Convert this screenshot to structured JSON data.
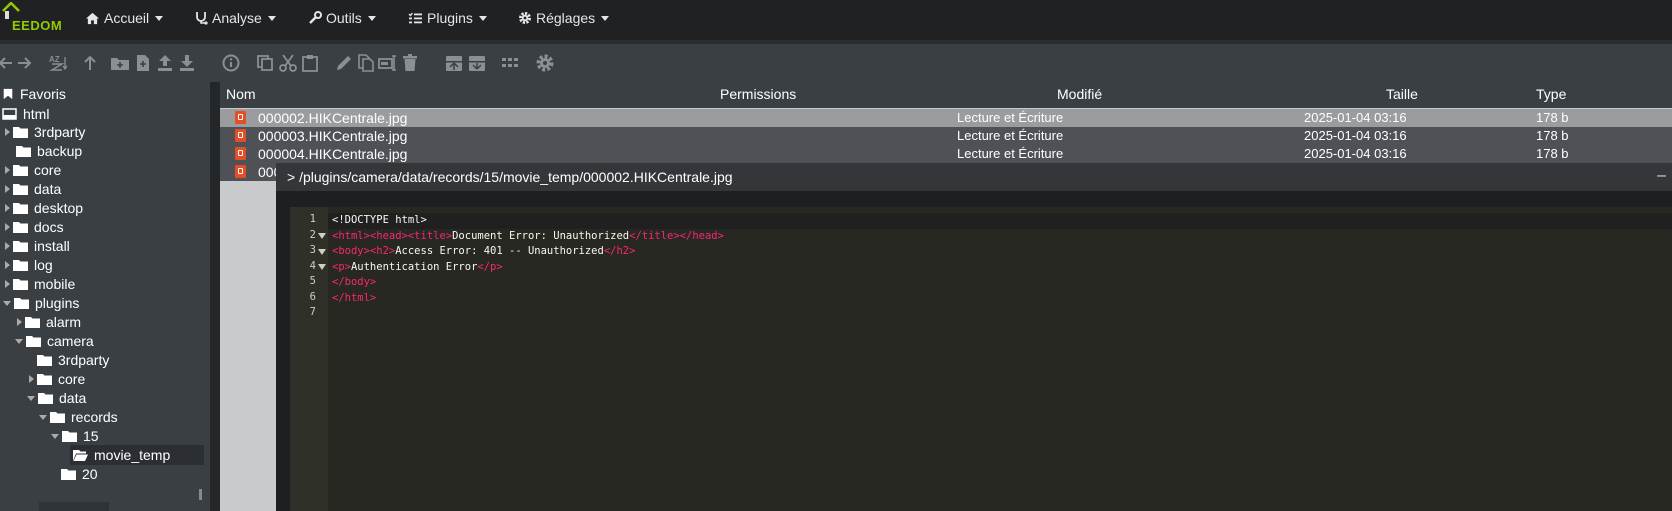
{
  "brand": {
    "text": "EEDOM",
    "color": "#94ca02"
  },
  "nav": [
    {
      "label": "Accueil",
      "icon": "home-icon"
    },
    {
      "label": "Analyse",
      "icon": "stethoscope-icon"
    },
    {
      "label": "Outils",
      "icon": "wrench-icon"
    },
    {
      "label": "Plugins",
      "icon": "tasks-icon"
    },
    {
      "label": "Réglages",
      "icon": "cog-icon"
    }
  ],
  "toolbar": [
    "back-icon",
    "forward-icon",
    "sort-icon",
    "up-icon",
    "new-folder-icon",
    "new-file-icon",
    "upload-icon",
    "download-icon",
    "info-icon",
    "copy-icon",
    "cut-icon",
    "paste-icon",
    "edit-icon",
    "duplicate-icon",
    "rename-icon",
    "delete-icon",
    "archive-icon",
    "extract-icon",
    "view-icon",
    "settings-icon"
  ],
  "tree": [
    {
      "label": "Favoris"
    },
    {
      "label": "html"
    },
    {
      "label": "3rdparty"
    },
    {
      "label": "backup"
    },
    {
      "label": "core"
    },
    {
      "label": "data"
    },
    {
      "label": "desktop"
    },
    {
      "label": "docs"
    },
    {
      "label": "install"
    },
    {
      "label": "log"
    },
    {
      "label": "mobile"
    },
    {
      "label": "plugins"
    },
    {
      "label": "alarm"
    },
    {
      "label": "camera"
    },
    {
      "label": "3rdparty"
    },
    {
      "label": "core"
    },
    {
      "label": "data"
    },
    {
      "label": "records"
    },
    {
      "label": "15"
    },
    {
      "label": "movie_temp"
    },
    {
      "label": "20"
    }
  ],
  "table": {
    "headers": {
      "name": "Nom",
      "perms": "Permissions",
      "modified": "Modifié",
      "size": "Taille",
      "type": "Type"
    },
    "rows": [
      {
        "name": "000002.HIKCentrale.jpg",
        "perms": "Lecture et Écriture",
        "modified": "2025-01-04 03:16",
        "size": "178 b"
      },
      {
        "name": "000003.HIKCentrale.jpg",
        "perms": "Lecture et Écriture",
        "modified": "2025-01-04 03:16",
        "size": "178 b"
      },
      {
        "name": "000004.HIKCentrale.jpg",
        "perms": "Lecture et Écriture",
        "modified": "2025-01-04 03:16",
        "size": "178 b"
      },
      {
        "name": "000"
      }
    ]
  },
  "editor": {
    "title": "> /plugins/camera/data/records/15/movie_temp/000002.HIKCentrale.jpg",
    "minimize": "–",
    "line_numbers": [
      "1",
      "2",
      "3",
      "4",
      "5",
      "6",
      "7"
    ],
    "code": {
      "l1": "<!DOCTYPE html>",
      "l2a": "<html><head><title>",
      "l2b": "Document Error: Unauthorized",
      "l2c": "</title></head>",
      "l3a": "<body><h2>",
      "l3b": "Access Error: 401 -- Unauthorized",
      "l3c": "</h2>",
      "l4a": "<p>",
      "l4b": "Authentication Error",
      "l4c": "</p>",
      "l5": "</body>",
      "l6": "</html>"
    }
  }
}
